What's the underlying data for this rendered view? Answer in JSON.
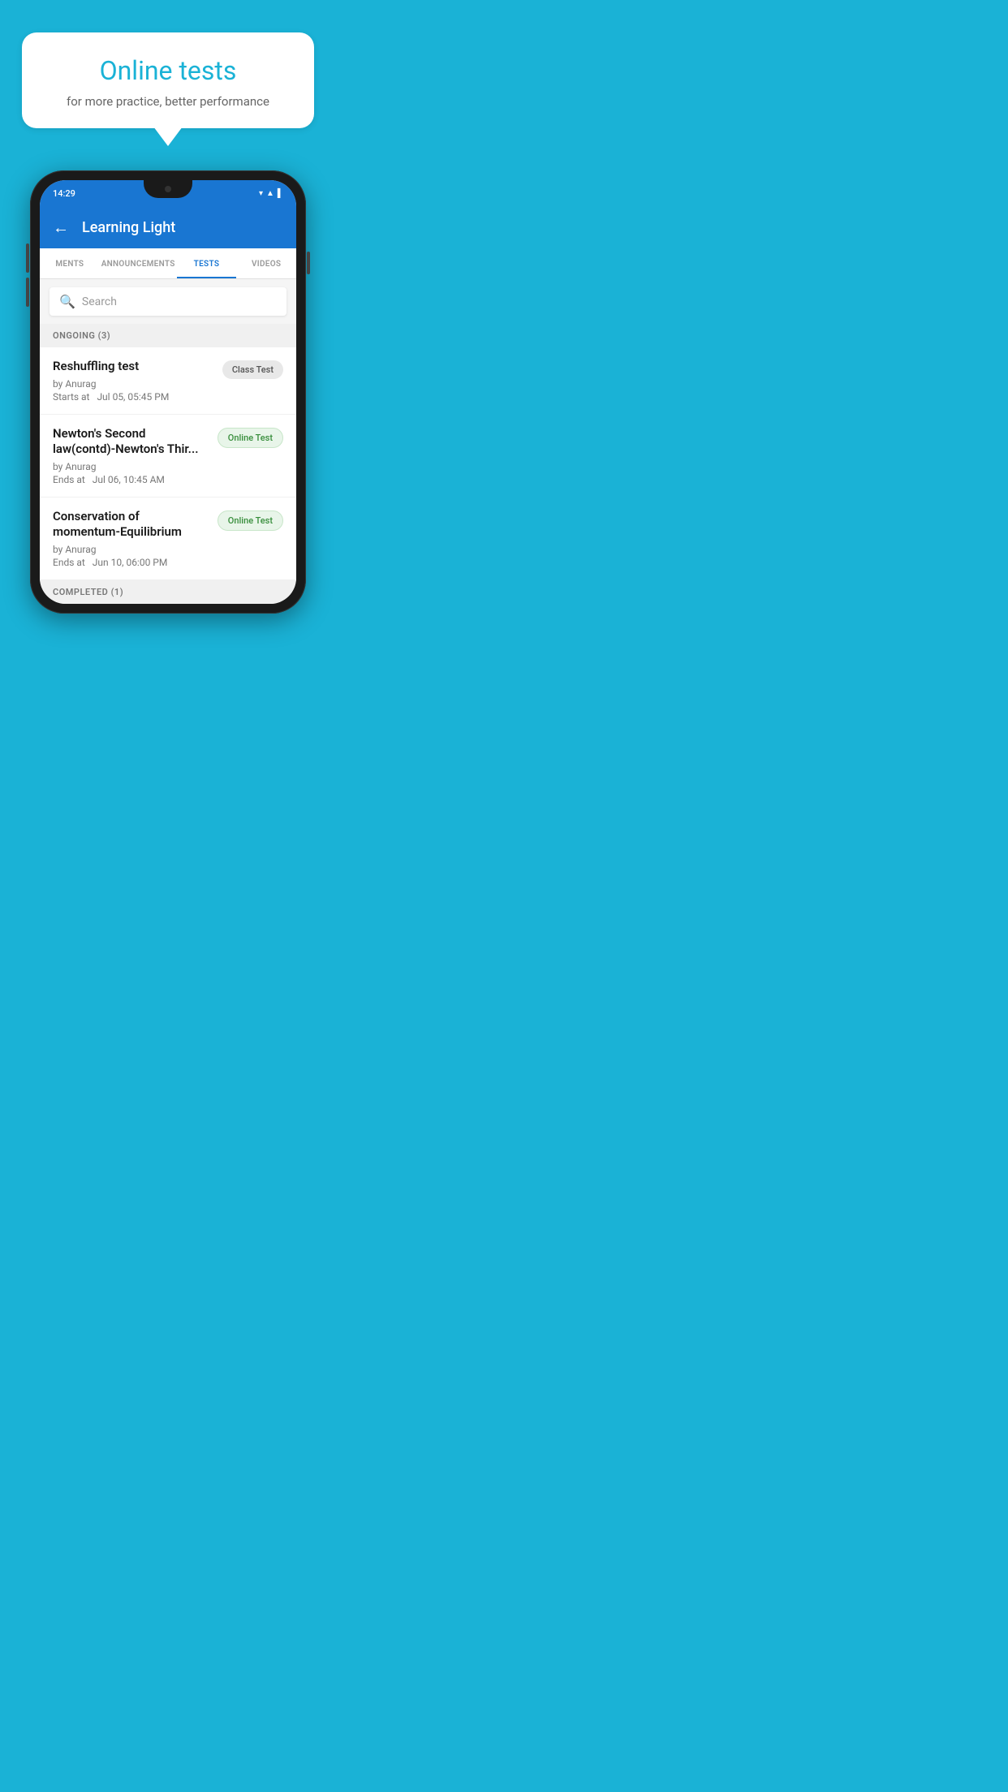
{
  "promo": {
    "title": "Online tests",
    "subtitle": "for more practice, better performance"
  },
  "status_bar": {
    "time": "14:29",
    "icons": [
      "▼",
      "▲",
      "▌"
    ]
  },
  "app_bar": {
    "title": "Learning Light",
    "back_label": "←"
  },
  "tabs": [
    {
      "label": "MENTS",
      "active": false
    },
    {
      "label": "ANNOUNCEMENTS",
      "active": false
    },
    {
      "label": "TESTS",
      "active": true
    },
    {
      "label": "VIDEOS",
      "active": false
    }
  ],
  "search": {
    "placeholder": "Search",
    "icon": "🔍"
  },
  "sections": [
    {
      "label": "ONGOING (3)",
      "items": [
        {
          "name": "Reshuffling test",
          "author": "by Anurag",
          "time_label": "Starts at",
          "time": "Jul 05, 05:45 PM",
          "badge": "Class Test",
          "badge_type": "class"
        },
        {
          "name": "Newton's Second law(contd)-Newton's Thir...",
          "author": "by Anurag",
          "time_label": "Ends at",
          "time": "Jul 06, 10:45 AM",
          "badge": "Online Test",
          "badge_type": "online"
        },
        {
          "name": "Conservation of momentum-Equilibrium",
          "author": "by Anurag",
          "time_label": "Ends at",
          "time": "Jun 10, 06:00 PM",
          "badge": "Online Test",
          "badge_type": "online"
        }
      ]
    }
  ],
  "completed_section": {
    "label": "COMPLETED (1)"
  },
  "colors": {
    "bg": "#1ab2d6",
    "primary": "#1976d2",
    "online_badge_bg": "#e8f5e9",
    "online_badge_text": "#388e3c",
    "class_badge_bg": "#e8e8e8",
    "class_badge_text": "#555"
  }
}
